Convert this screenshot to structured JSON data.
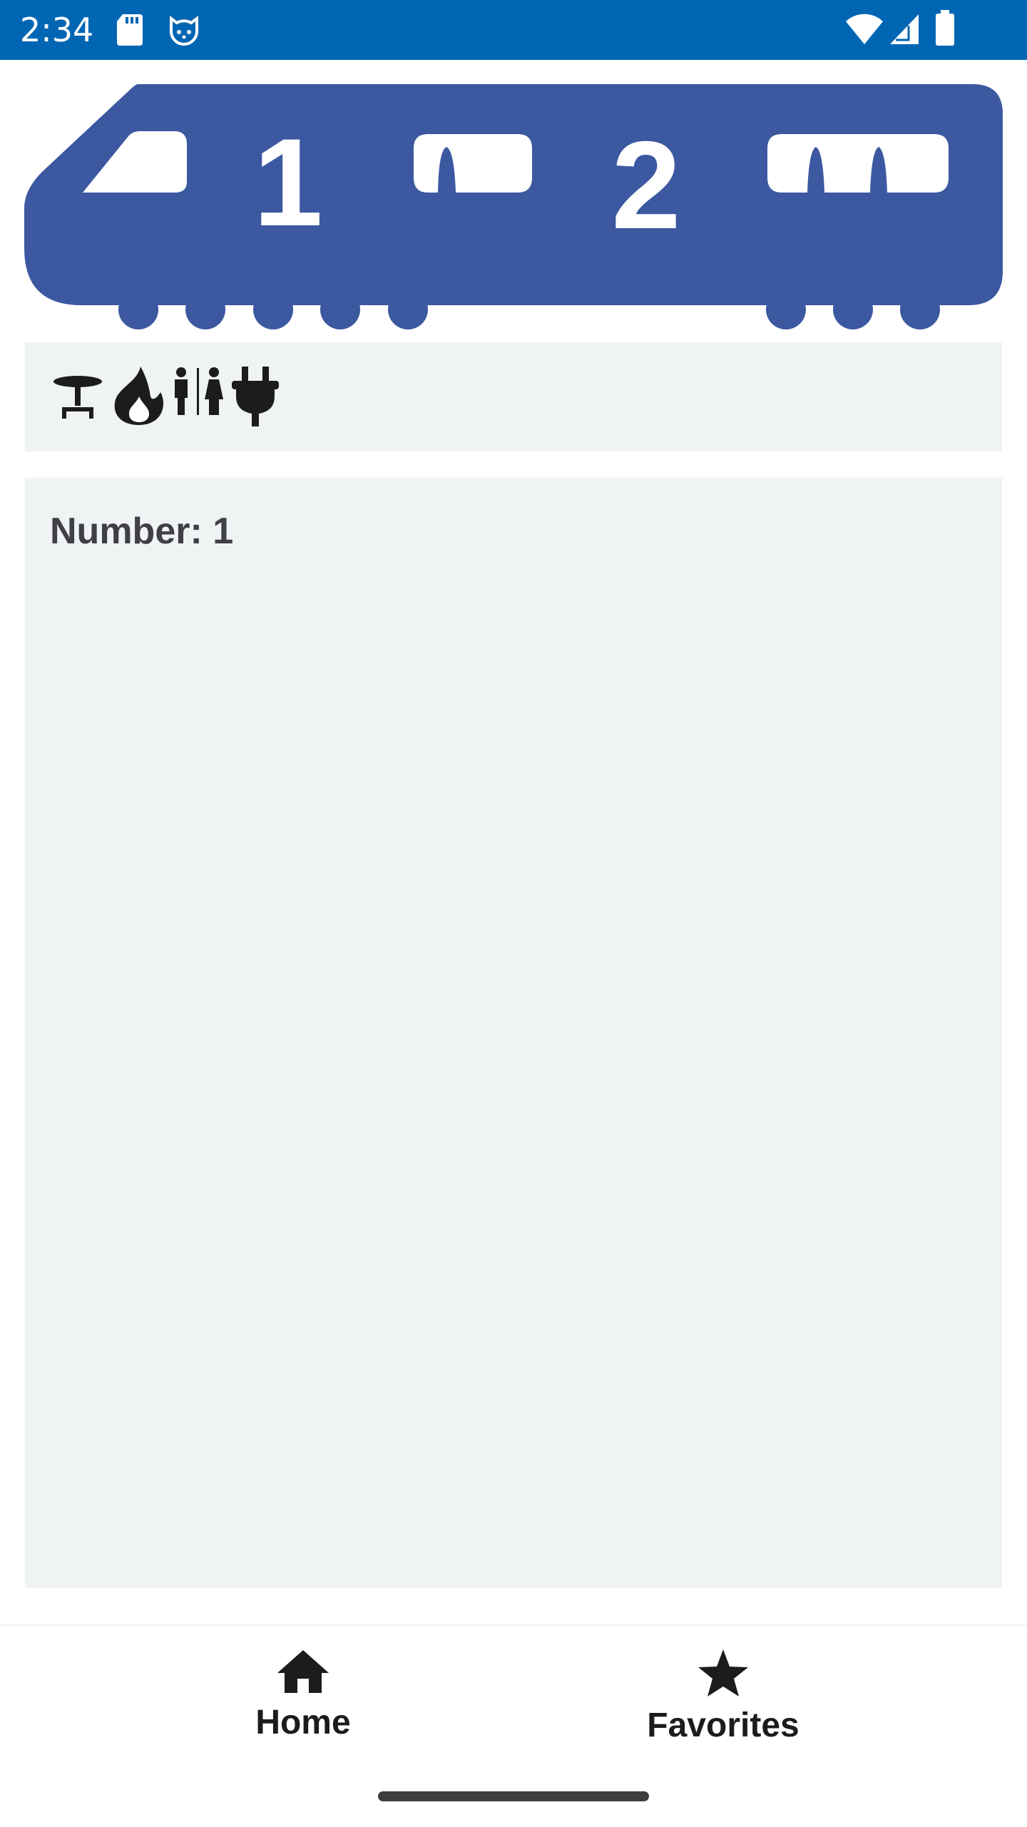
{
  "status_bar": {
    "time": "2:34",
    "background": "#0066b3",
    "left_icons": [
      "sd-card-icon",
      "cat-face-icon"
    ],
    "right_icons": [
      "wifi-icon",
      "cell-signal-icon",
      "battery-icon"
    ]
  },
  "banner": {
    "train_color": "#3b58a0",
    "class_numbers": [
      "1",
      "2"
    ]
  },
  "amenities": {
    "icons": [
      "restaurant-table-icon",
      "fire-icon",
      "toilets-icon",
      "power-plug-icon"
    ]
  },
  "details": {
    "number_label": "Number: 1"
  },
  "bottom_nav": {
    "items": [
      {
        "label": "Home",
        "icon": "home-icon"
      },
      {
        "label": "Favorites",
        "icon": "star-icon"
      }
    ]
  },
  "colors": {
    "accent": "#0066b3",
    "panel": "#eff3f4",
    "text": "#3f3f45"
  }
}
